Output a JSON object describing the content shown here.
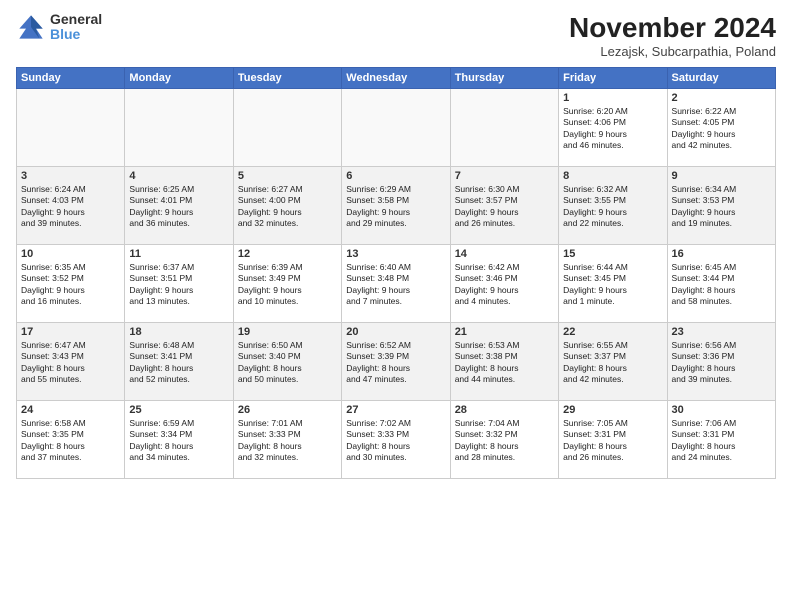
{
  "logo": {
    "general": "General",
    "blue": "Blue"
  },
  "title": "November 2024",
  "location": "Lezajsk, Subcarpathia, Poland",
  "weekdays": [
    "Sunday",
    "Monday",
    "Tuesday",
    "Wednesday",
    "Thursday",
    "Friday",
    "Saturday"
  ],
  "weeks": [
    [
      {
        "day": "",
        "info": ""
      },
      {
        "day": "",
        "info": ""
      },
      {
        "day": "",
        "info": ""
      },
      {
        "day": "",
        "info": ""
      },
      {
        "day": "",
        "info": ""
      },
      {
        "day": "1",
        "info": "Sunrise: 6:20 AM\nSunset: 4:06 PM\nDaylight: 9 hours\nand 46 minutes."
      },
      {
        "day": "2",
        "info": "Sunrise: 6:22 AM\nSunset: 4:05 PM\nDaylight: 9 hours\nand 42 minutes."
      }
    ],
    [
      {
        "day": "3",
        "info": "Sunrise: 6:24 AM\nSunset: 4:03 PM\nDaylight: 9 hours\nand 39 minutes."
      },
      {
        "day": "4",
        "info": "Sunrise: 6:25 AM\nSunset: 4:01 PM\nDaylight: 9 hours\nand 36 minutes."
      },
      {
        "day": "5",
        "info": "Sunrise: 6:27 AM\nSunset: 4:00 PM\nDaylight: 9 hours\nand 32 minutes."
      },
      {
        "day": "6",
        "info": "Sunrise: 6:29 AM\nSunset: 3:58 PM\nDaylight: 9 hours\nand 29 minutes."
      },
      {
        "day": "7",
        "info": "Sunrise: 6:30 AM\nSunset: 3:57 PM\nDaylight: 9 hours\nand 26 minutes."
      },
      {
        "day": "8",
        "info": "Sunrise: 6:32 AM\nSunset: 3:55 PM\nDaylight: 9 hours\nand 22 minutes."
      },
      {
        "day": "9",
        "info": "Sunrise: 6:34 AM\nSunset: 3:53 PM\nDaylight: 9 hours\nand 19 minutes."
      }
    ],
    [
      {
        "day": "10",
        "info": "Sunrise: 6:35 AM\nSunset: 3:52 PM\nDaylight: 9 hours\nand 16 minutes."
      },
      {
        "day": "11",
        "info": "Sunrise: 6:37 AM\nSunset: 3:51 PM\nDaylight: 9 hours\nand 13 minutes."
      },
      {
        "day": "12",
        "info": "Sunrise: 6:39 AM\nSunset: 3:49 PM\nDaylight: 9 hours\nand 10 minutes."
      },
      {
        "day": "13",
        "info": "Sunrise: 6:40 AM\nSunset: 3:48 PM\nDaylight: 9 hours\nand 7 minutes."
      },
      {
        "day": "14",
        "info": "Sunrise: 6:42 AM\nSunset: 3:46 PM\nDaylight: 9 hours\nand 4 minutes."
      },
      {
        "day": "15",
        "info": "Sunrise: 6:44 AM\nSunset: 3:45 PM\nDaylight: 9 hours\nand 1 minute."
      },
      {
        "day": "16",
        "info": "Sunrise: 6:45 AM\nSunset: 3:44 PM\nDaylight: 8 hours\nand 58 minutes."
      }
    ],
    [
      {
        "day": "17",
        "info": "Sunrise: 6:47 AM\nSunset: 3:43 PM\nDaylight: 8 hours\nand 55 minutes."
      },
      {
        "day": "18",
        "info": "Sunrise: 6:48 AM\nSunset: 3:41 PM\nDaylight: 8 hours\nand 52 minutes."
      },
      {
        "day": "19",
        "info": "Sunrise: 6:50 AM\nSunset: 3:40 PM\nDaylight: 8 hours\nand 50 minutes."
      },
      {
        "day": "20",
        "info": "Sunrise: 6:52 AM\nSunset: 3:39 PM\nDaylight: 8 hours\nand 47 minutes."
      },
      {
        "day": "21",
        "info": "Sunrise: 6:53 AM\nSunset: 3:38 PM\nDaylight: 8 hours\nand 44 minutes."
      },
      {
        "day": "22",
        "info": "Sunrise: 6:55 AM\nSunset: 3:37 PM\nDaylight: 8 hours\nand 42 minutes."
      },
      {
        "day": "23",
        "info": "Sunrise: 6:56 AM\nSunset: 3:36 PM\nDaylight: 8 hours\nand 39 minutes."
      }
    ],
    [
      {
        "day": "24",
        "info": "Sunrise: 6:58 AM\nSunset: 3:35 PM\nDaylight: 8 hours\nand 37 minutes."
      },
      {
        "day": "25",
        "info": "Sunrise: 6:59 AM\nSunset: 3:34 PM\nDaylight: 8 hours\nand 34 minutes."
      },
      {
        "day": "26",
        "info": "Sunrise: 7:01 AM\nSunset: 3:33 PM\nDaylight: 8 hours\nand 32 minutes."
      },
      {
        "day": "27",
        "info": "Sunrise: 7:02 AM\nSunset: 3:33 PM\nDaylight: 8 hours\nand 30 minutes."
      },
      {
        "day": "28",
        "info": "Sunrise: 7:04 AM\nSunset: 3:32 PM\nDaylight: 8 hours\nand 28 minutes."
      },
      {
        "day": "29",
        "info": "Sunrise: 7:05 AM\nSunset: 3:31 PM\nDaylight: 8 hours\nand 26 minutes."
      },
      {
        "day": "30",
        "info": "Sunrise: 7:06 AM\nSunset: 3:31 PM\nDaylight: 8 hours\nand 24 minutes."
      }
    ]
  ]
}
